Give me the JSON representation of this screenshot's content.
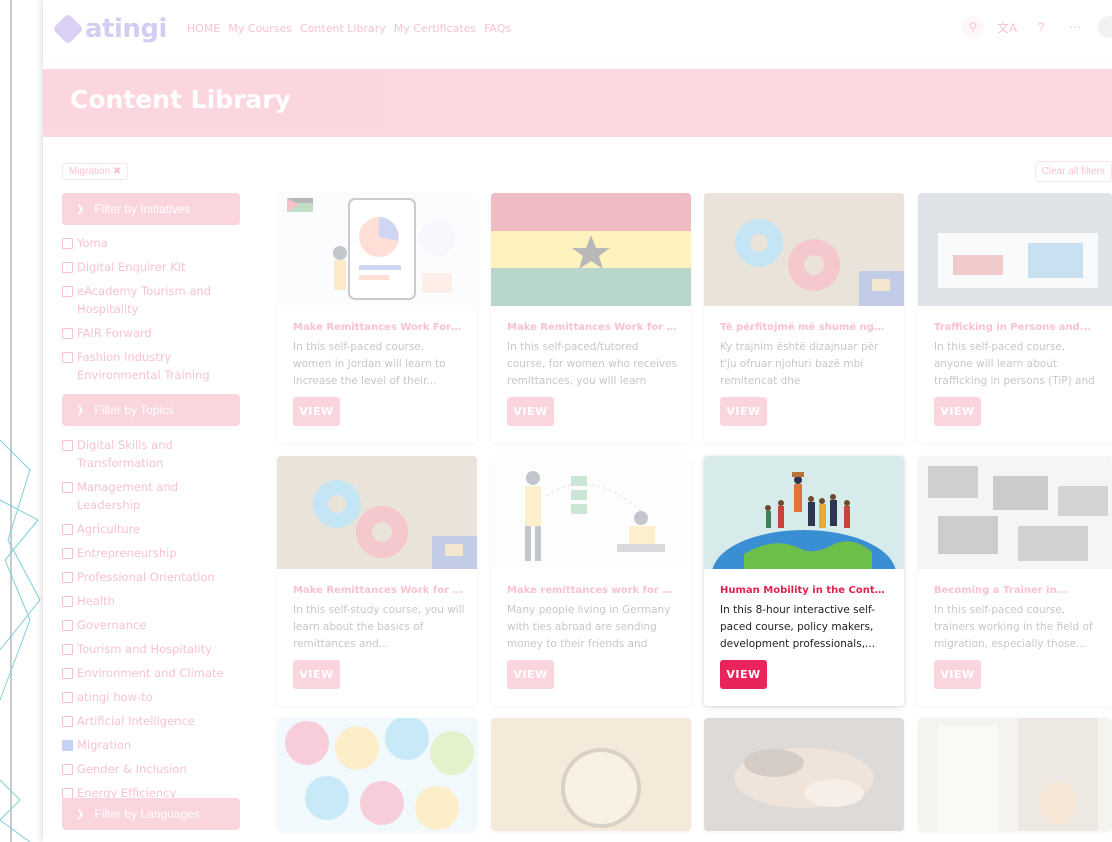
{
  "nav": {
    "logo_text": "atingi",
    "links": [
      "HOME",
      "My Courses",
      "Content Library",
      "My Certificates",
      "FAQs"
    ]
  },
  "banner": {
    "title": "Content Library"
  },
  "filters": {
    "active_chip": "Migration ✖",
    "clear_all": "Clear all filters",
    "initiatives": {
      "heading": "Filter by Initiatives",
      "items": [
        {
          "label": "Yoma",
          "checked": false
        },
        {
          "label": "Digital Enquirer Kit",
          "checked": false
        },
        {
          "label": "eAcademy Tourism and Hospitality",
          "checked": false
        },
        {
          "label": "FAIR Forward",
          "checked": false
        },
        {
          "label": "Fashion Industry Environmental Training",
          "checked": false
        }
      ]
    },
    "topics": {
      "heading": "Filter by Topics",
      "items": [
        {
          "label": "Digital Skills and Transformation",
          "checked": false
        },
        {
          "label": "Management and Leadership",
          "checked": false
        },
        {
          "label": "Agriculture",
          "checked": false
        },
        {
          "label": "Entrepreneurship",
          "checked": false
        },
        {
          "label": "Professional Orientation",
          "checked": false
        },
        {
          "label": "Health",
          "checked": false
        },
        {
          "label": "Governance",
          "checked": false
        },
        {
          "label": "Tourism and Hospitality",
          "checked": false
        },
        {
          "label": "Environment and Climate",
          "checked": false
        },
        {
          "label": "atingi how-to",
          "checked": false
        },
        {
          "label": "Artificial Intelligence",
          "checked": false
        },
        {
          "label": "Migration",
          "checked": true
        },
        {
          "label": "Gender & Inclusion",
          "checked": false
        },
        {
          "label": "Energy Efficiency",
          "checked": false
        }
      ]
    },
    "languages": {
      "heading": "Filter by Languages"
    }
  },
  "cards": [
    {
      "title": "Make Remittances Work For Yo...",
      "desc": "In this self-paced course, women in Jordan will learn to increase the level of their...",
      "button": "VIEW",
      "thumb": "jordan-illustration"
    },
    {
      "title": "Make Remittances Work for Yo...",
      "desc": "In this self-paced/tutored course, for women who receives remittances, you will learn how...",
      "button": "VIEW",
      "thumb": "ghana-flag"
    },
    {
      "title": "Të përfitojmë më shumë nga...",
      "desc": "Ky trajnim është dizajnuar për t'ju ofruar njohuri bazë mbi remitencat dhe ndërmarrësinë,...",
      "button": "VIEW",
      "thumb": "gears-kosovo"
    },
    {
      "title": "Trafficking in Persons and...",
      "desc": "In this self-paced course, anyone will learn about trafficking in persons (TiP) and Smuggling of...",
      "button": "VIEW",
      "thumb": "stop-trafficking-photo"
    },
    {
      "title": "Make Remittances Work for Yo...",
      "desc": "In this self-study course, you will learn about the basics of remittances and...",
      "button": "VIEW",
      "thumb": "gears-kosovo"
    },
    {
      "title": "Make remittances work for you ...",
      "desc": "Many people living in Germany with ties abroad are sending money to their friends and fami...",
      "button": "VIEW",
      "thumb": "money-transfer-illustration"
    },
    {
      "title": "Human Mobility in the Context ...",
      "desc": "In this 8-hour interactive self-paced course, policy makers, development professionals,...",
      "button": "VIEW",
      "thumb": "globe-people-illustration"
    },
    {
      "title": "Becoming a Trainer in...",
      "desc": "In this self-paced course, trainers working in the field of migration, especially those...",
      "button": "VIEW",
      "thumb": "laptops-desk-photo"
    },
    {
      "thumb": "umbrellas-photo"
    },
    {
      "thumb": "magnifier-map-photo"
    },
    {
      "thumb": "joined-hands-photo"
    },
    {
      "thumb": "cat-window-photo"
    }
  ],
  "colors": {
    "brand": "#e0244f",
    "accent_purple": "#6a4fd0",
    "button_active": "#e8245a",
    "checkbox_checked": "#2d5fd3"
  }
}
